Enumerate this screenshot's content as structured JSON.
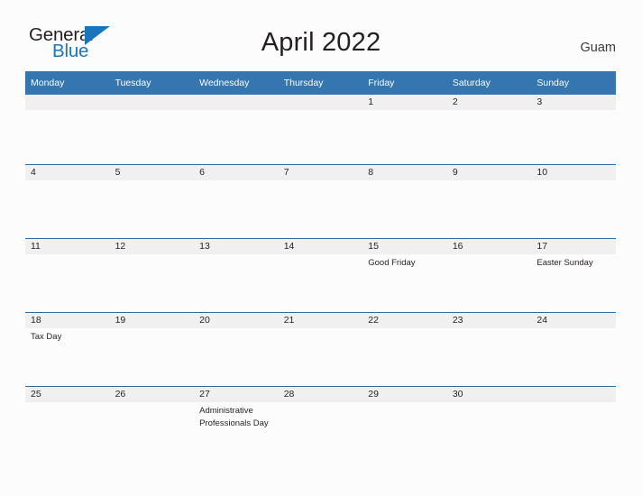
{
  "brand": {
    "name_top": "General",
    "name_bottom": "Blue",
    "flag_color": "#1b75bb",
    "text_color": "#231f20"
  },
  "header": {
    "title": "April 2022",
    "location": "Guam"
  },
  "theme": {
    "header_blue": "#3575b0",
    "divider_blue": "#2d6da4",
    "date_band_gray": "#f0f0f0",
    "page_background": "#fcfcfc",
    "text_color": "#231f20"
  },
  "calendar": {
    "weekdays": [
      "Monday",
      "Tuesday",
      "Wednesday",
      "Thursday",
      "Friday",
      "Saturday",
      "Sunday"
    ],
    "weeks": [
      [
        {
          "date": "",
          "event": ""
        },
        {
          "date": "",
          "event": ""
        },
        {
          "date": "",
          "event": ""
        },
        {
          "date": "",
          "event": ""
        },
        {
          "date": "1",
          "event": ""
        },
        {
          "date": "2",
          "event": ""
        },
        {
          "date": "3",
          "event": ""
        }
      ],
      [
        {
          "date": "4",
          "event": ""
        },
        {
          "date": "5",
          "event": ""
        },
        {
          "date": "6",
          "event": ""
        },
        {
          "date": "7",
          "event": ""
        },
        {
          "date": "8",
          "event": ""
        },
        {
          "date": "9",
          "event": ""
        },
        {
          "date": "10",
          "event": ""
        }
      ],
      [
        {
          "date": "11",
          "event": ""
        },
        {
          "date": "12",
          "event": ""
        },
        {
          "date": "13",
          "event": ""
        },
        {
          "date": "14",
          "event": ""
        },
        {
          "date": "15",
          "event": "Good Friday"
        },
        {
          "date": "16",
          "event": ""
        },
        {
          "date": "17",
          "event": "Easter Sunday"
        }
      ],
      [
        {
          "date": "18",
          "event": "Tax Day"
        },
        {
          "date": "19",
          "event": ""
        },
        {
          "date": "20",
          "event": ""
        },
        {
          "date": "21",
          "event": ""
        },
        {
          "date": "22",
          "event": ""
        },
        {
          "date": "23",
          "event": ""
        },
        {
          "date": "24",
          "event": ""
        }
      ],
      [
        {
          "date": "25",
          "event": ""
        },
        {
          "date": "26",
          "event": ""
        },
        {
          "date": "27",
          "event": "Administrative Professionals Day"
        },
        {
          "date": "28",
          "event": ""
        },
        {
          "date": "29",
          "event": ""
        },
        {
          "date": "30",
          "event": ""
        },
        {
          "date": "",
          "event": ""
        }
      ]
    ]
  }
}
